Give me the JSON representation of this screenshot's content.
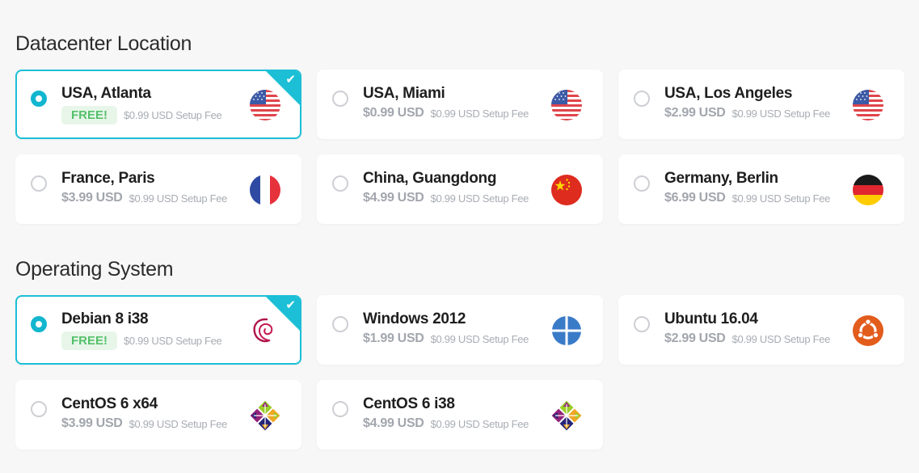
{
  "datacenter": {
    "title": "Datacenter Location",
    "options": [
      {
        "name": "USA, Atlanta",
        "price": "FREE!",
        "free": true,
        "setup": "$0.99 USD Setup Fee",
        "selected": true,
        "icon": "us-flag-icon"
      },
      {
        "name": "USA, Miami",
        "price": "$0.99 USD",
        "free": false,
        "setup": "$0.99 USD Setup Fee",
        "selected": false,
        "icon": "us-flag-icon"
      },
      {
        "name": "USA, Los Angeles",
        "price": "$2.99 USD",
        "free": false,
        "setup": "$0.99 USD Setup Fee",
        "selected": false,
        "icon": "us-flag-icon"
      },
      {
        "name": "France, Paris",
        "price": "$3.99 USD",
        "free": false,
        "setup": "$0.99 USD Setup Fee",
        "selected": false,
        "icon": "france-flag-icon"
      },
      {
        "name": "China, Guangdong",
        "price": "$4.99 USD",
        "free": false,
        "setup": "$0.99 USD Setup Fee",
        "selected": false,
        "icon": "china-flag-icon"
      },
      {
        "name": "Germany, Berlin",
        "price": "$6.99 USD",
        "free": false,
        "setup": "$0.99 USD Setup Fee",
        "selected": false,
        "icon": "germany-flag-icon"
      }
    ]
  },
  "os": {
    "title": "Operating System",
    "options": [
      {
        "name": "Debian 8 i38",
        "price": "FREE!",
        "free": true,
        "setup": "$0.99 USD Setup Fee",
        "selected": true,
        "icon": "debian-logo-icon"
      },
      {
        "name": "Windows 2012",
        "price": "$1.99 USD",
        "free": false,
        "setup": "$0.99 USD Setup Fee",
        "selected": false,
        "icon": "windows-logo-icon"
      },
      {
        "name": "Ubuntu 16.04",
        "price": "$2.99 USD",
        "free": false,
        "setup": "$0.99 USD Setup Fee",
        "selected": false,
        "icon": "ubuntu-logo-icon"
      },
      {
        "name": "CentOS 6 x64",
        "price": "$3.99 USD",
        "free": false,
        "setup": "$0.99 USD Setup Fee",
        "selected": false,
        "icon": "centos-logo-icon"
      },
      {
        "name": "CentOS 6 i38",
        "price": "$4.99 USD",
        "free": false,
        "setup": "$0.99 USD Setup Fee",
        "selected": false,
        "icon": "centos-logo-icon"
      }
    ]
  },
  "colors": {
    "accent": "#1cbfd6",
    "free_text": "#55c06a",
    "free_bg": "#e8f6ea",
    "price": "#a2a6ad"
  }
}
